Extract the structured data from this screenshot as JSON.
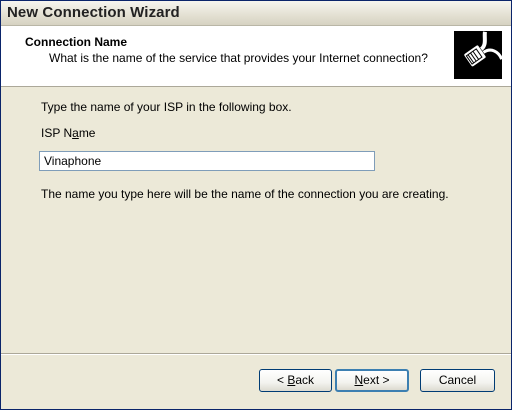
{
  "window": {
    "title": "New Connection Wizard"
  },
  "header": {
    "title": "Connection Name",
    "subtitle": "What is the name of the service that provides your Internet connection?",
    "icon": "phone-plug-icon"
  },
  "content": {
    "instruction": "Type the name of your ISP in the following box.",
    "isp_label_pre": "ISP N",
    "isp_label_underlined": "a",
    "isp_label_post": "me",
    "isp_value": "Vinaphone",
    "note": "The name you type here will be the name of the connection you are creating."
  },
  "buttons": {
    "back_pre": "< ",
    "back_underlined": "B",
    "back_post": "ack",
    "next_underlined": "N",
    "next_post": "ext >",
    "cancel": "Cancel"
  }
}
